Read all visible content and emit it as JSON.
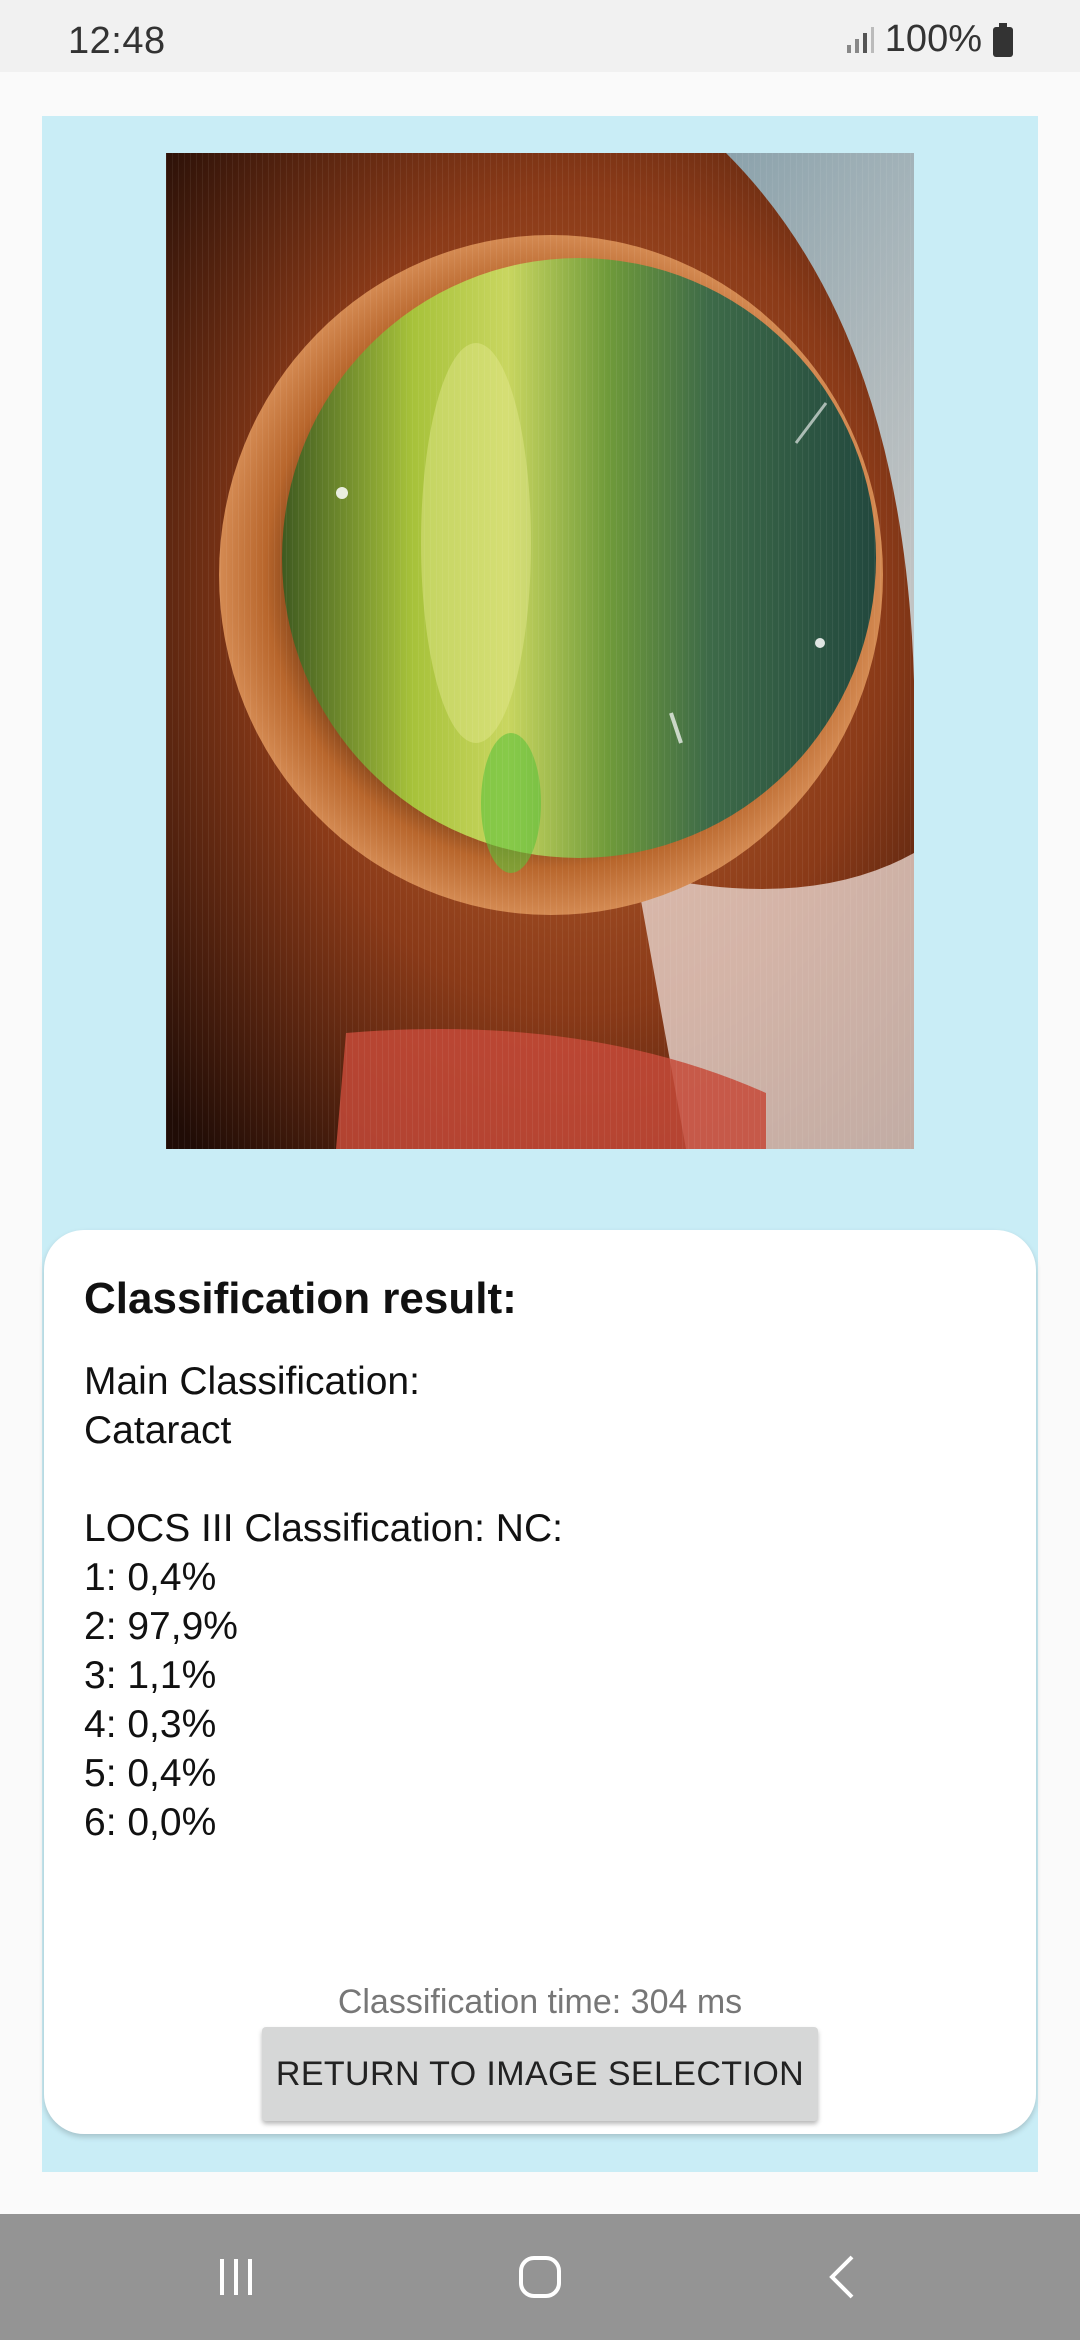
{
  "status_bar": {
    "time": "12:48",
    "battery": "100%",
    "icons": [
      "signal-icon",
      "battery-icon"
    ]
  },
  "image": {
    "description_icon": "eye-photo"
  },
  "result": {
    "title": "Classification result:",
    "main_label": "Main Classification:",
    "main_value": "Cataract",
    "locs_label": "LOCS III Classification: NC:",
    "locs_values": [
      "1: 0,4%",
      "2: 97,9%",
      "3: 1,1%",
      "4: 0,3%",
      "5: 0,4%",
      "6: 0,0%"
    ],
    "time": "Classification time: 304 ms"
  },
  "button": {
    "return_label": "RETURN TO IMAGE SELECTION"
  },
  "nav": {
    "icons": [
      "recents-icon",
      "home-icon",
      "back-icon"
    ]
  },
  "colors": {
    "content_bg": "#c9edf6",
    "card_bg": "#ffffff",
    "button_bg": "#d6d7d7",
    "nav_bg": "#949494"
  }
}
